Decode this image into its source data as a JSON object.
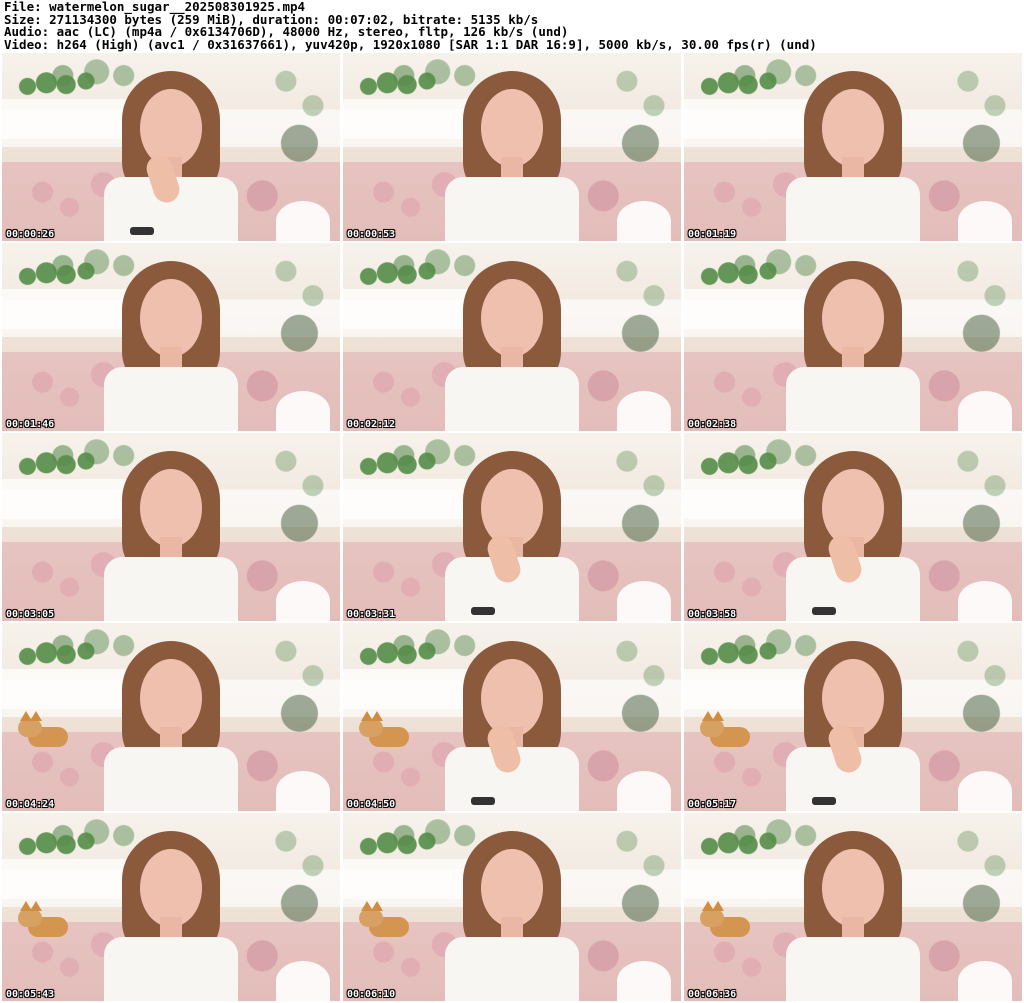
{
  "header": {
    "line1": "File: watermelon_sugar__202508301925.mp4",
    "line2": "Size: 271134300 bytes (259 MiB), duration: 00:07:02, bitrate: 5135 kb/s",
    "line3": "Audio: aac (LC) (mp4a / 0x6134706D), 48000 Hz, stereo, fltp, 126 kb/s (und)",
    "line4": "Video: h264 (High) (avc1 / 0x31637661), yuv420p, 1920x1080 [SAR 1:1 DAR 16:9], 5000 kb/s, 30.00 fps(r) (und)"
  },
  "thumbnails": [
    {
      "timestamp": "00:00:26"
    },
    {
      "timestamp": "00:00:53"
    },
    {
      "timestamp": "00:01:19"
    },
    {
      "timestamp": "00:01:46"
    },
    {
      "timestamp": "00:02:12"
    },
    {
      "timestamp": "00:02:38"
    },
    {
      "timestamp": "00:03:05"
    },
    {
      "timestamp": "00:03:31"
    },
    {
      "timestamp": "00:03:58"
    },
    {
      "timestamp": "00:04:24"
    },
    {
      "timestamp": "00:04:50"
    },
    {
      "timestamp": "00:05:17"
    },
    {
      "timestamp": "00:05:43"
    },
    {
      "timestamp": "00:06:10"
    },
    {
      "timestamp": "00:06:36"
    }
  ]
}
